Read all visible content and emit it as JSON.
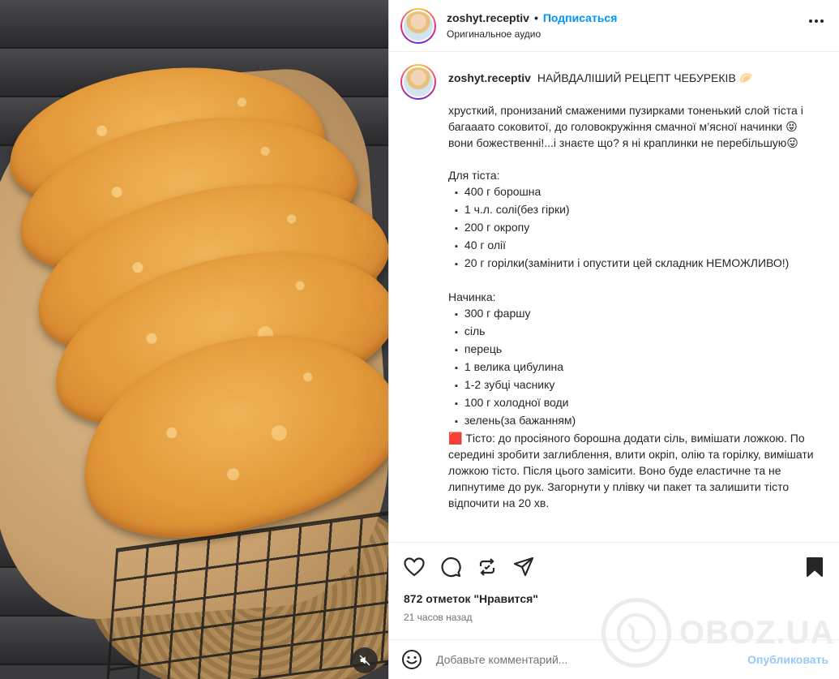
{
  "post": {
    "username": "zoshyt.receptiv",
    "separator": "•",
    "follow_label": "Подписаться",
    "audio_label": "Оригинальное аудио",
    "more_icon": "more-horizontal-icon"
  },
  "caption": {
    "username": "zoshyt.receptiv",
    "title": "НАЙВДАЛІШИЙ РЕЦЕПТ ЧЕБУРЕКІВ 🥟",
    "intro1": "хрусткий, пронизаний смаженими пузирками тоненький слой тіста і багааато соковитої, до головокружіння смачної м’ясної начинки 😝",
    "intro2": "вони божественні!...і знаєте що? я ні краплинки не перебільшую😜",
    "dough_heading": "Для тіста:",
    "dough_items": [
      "400 г борошна",
      "1 ч.л. солі(без гірки)",
      "200 г окропу",
      "40 г олії",
      "20 г горілки(замінити і опустити цей складник НЕМОЖЛИВО!)"
    ],
    "filling_heading": "Начинка:",
    "filling_items": [
      "300 г фаршу",
      "сіль",
      "перець",
      "1 велика цибулина",
      "1-2 зубці часнику",
      "100 г холодної води",
      "зелень(за бажанням)"
    ],
    "step1": "🟥 Тісто: до просіяного борошна додати сіль, вимішати ложкою. По середині зробити заглиблення, влити окріп, олію та горілку, вимішати ложкою тісто. Після цього замісити. Воно буде еластичне та не липнутиме до рук. Загорнути у плівку чи пакет та залишити тісто відпочити на 20 хв."
  },
  "actions": {
    "like_icon": "heart-icon",
    "comment_icon": "comment-icon",
    "repost_icon": "repost-icon",
    "share_icon": "send-icon",
    "save_icon": "bookmark-icon"
  },
  "likes_text": "872 отметок \"Нравится\"",
  "time_text": "21 часов назад",
  "comment": {
    "placeholder": "Добавьте комментарий...",
    "post_label": "Опубликовать"
  },
  "watermark": "OBOZ.UA",
  "colors": {
    "accent": "#0095f6",
    "post_disabled": "#9ac8f5",
    "text": "#262626",
    "secondary": "#737373"
  }
}
